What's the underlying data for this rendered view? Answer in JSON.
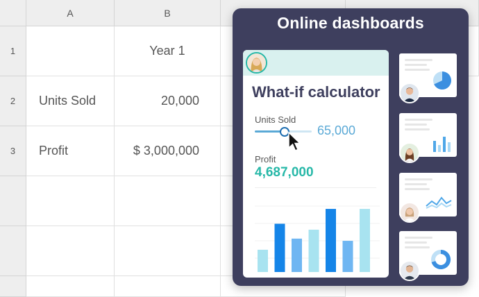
{
  "spreadsheet": {
    "columns": [
      "A",
      "B"
    ],
    "rows": [
      "1",
      "2",
      "3",
      "",
      "",
      ""
    ],
    "cells": {
      "b1": "Year 1",
      "a2": "Units Sold",
      "b2": "20,000",
      "a3": "Profit",
      "b3": "$ 3,000,000"
    }
  },
  "dashboard": {
    "title": "Online dashboards",
    "calculator": {
      "title": "What-if calculator",
      "units_label": "Units Sold",
      "units_value": "65,000",
      "units_slider_fraction": 0.52,
      "profit_label": "Profit",
      "profit_value": "4,687,000"
    },
    "bar_chart": {
      "values": [
        30,
        65,
        45,
        57,
        85,
        42,
        85
      ],
      "colors": [
        "#a8e3f0",
        "#1585e8",
        "#6fb6f2",
        "#a8e3f0",
        "#1585e8",
        "#6fb6f2",
        "#a8e3f0"
      ]
    },
    "thumbnails": [
      {
        "name": "pie",
        "frame": "#f6c9cf",
        "accent": "#3b8fe0"
      },
      {
        "name": "bars",
        "frame": "#c5ebc6",
        "accent": "#4fa7e8"
      },
      {
        "name": "line",
        "frame": "#f8cfbf",
        "accent": "#4fa7e8"
      },
      {
        "name": "donut",
        "frame": "#d3c4ea",
        "accent": "#3b8fe0"
      }
    ]
  },
  "colors": {
    "panel_bg": "#3e3f5e",
    "teal": "#27b8a8",
    "slider_blue": "#5aa9d6"
  },
  "icons": [
    "avatar-icon",
    "mouse-pointer-icon",
    "pie-chart-icon",
    "bar-chart-icon",
    "line-chart-icon",
    "donut-chart-icon"
  ]
}
